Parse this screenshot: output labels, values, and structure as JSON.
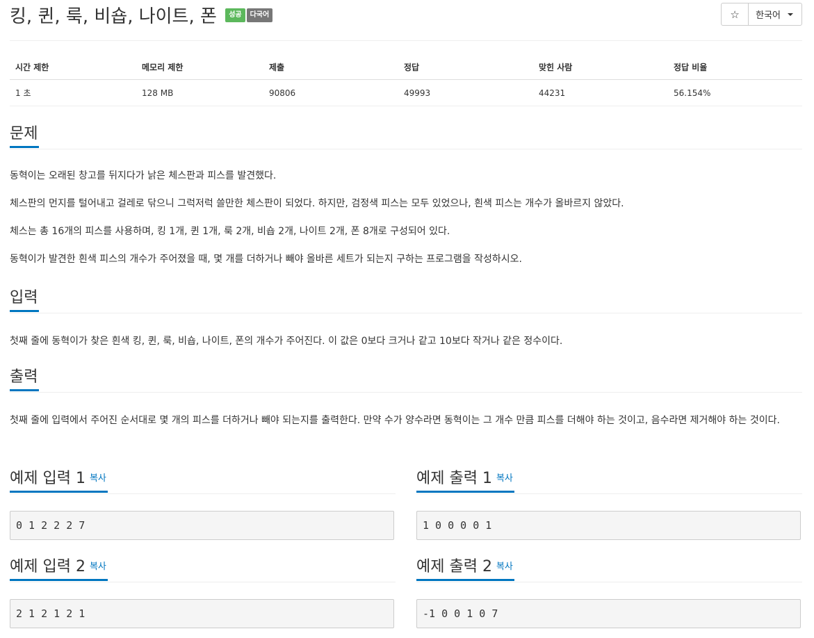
{
  "problem": {
    "title": "킹, 퀸, 룩, 비숍, 나이트, 폰",
    "badges": [
      "성공",
      "다국어"
    ],
    "star_icon": "☆",
    "language": "한국어",
    "colors": {
      "accent": "#0076c0",
      "success": "#5cb85c",
      "multilang": "#777777"
    }
  },
  "stats": {
    "headers": [
      "시간 제한",
      "메모리 제한",
      "제출",
      "정답",
      "맞힌 사람",
      "정답 비율"
    ],
    "values": [
      "1 초",
      "128 MB",
      "90806",
      "49993",
      "44231",
      "56.154%"
    ]
  },
  "description": {
    "title": "문제",
    "paragraphs": [
      "동혁이는 오래된 창고를 뒤지다가 낡은 체스판과 피스를 발견했다.",
      "체스판의 먼지를 털어내고 걸레로 닦으니 그럭저럭 쓸만한 체스판이 되었다. 하지만, 검정색 피스는 모두 있었으나, 흰색 피스는 개수가 올바르지 않았다.",
      "체스는 총 16개의 피스를 사용하며, 킹 1개, 퀸 1개, 룩 2개, 비숍 2개, 나이트 2개, 폰 8개로 구성되어 있다.",
      "동혁이가 발견한 흰색 피스의 개수가 주어졌을 때, 몇 개를 더하거나 빼야 올바른 세트가 되는지 구하는 프로그램을 작성하시오."
    ]
  },
  "input": {
    "title": "입력",
    "text": "첫째 줄에 동혁이가 찾은 흰색 킹, 퀸, 룩, 비숍, 나이트, 폰의 개수가 주어진다. 이 값은 0보다 크거나 같고 10보다 작거나 같은 정수이다."
  },
  "output": {
    "title": "출력",
    "text": "첫째 줄에 입력에서 주어진 순서대로 몇 개의 피스를 더하거나 빼야 되는지를 출력한다. 만약 수가 양수라면 동혁이는 그 개수 만큼 피스를 더해야 하는 것이고, 음수라면 제거해야 하는 것이다."
  },
  "samples": {
    "copy_label": "복사",
    "input1": {
      "title": "예제 입력 1",
      "value": "0 1 2 2 2 7"
    },
    "output1": {
      "title": "예제 출력 1",
      "value": "1 0 0 0 0 1"
    },
    "input2": {
      "title": "예제 입력 2",
      "value": "2 1 2 1 2 1"
    },
    "output2": {
      "title": "예제 출력 2",
      "value": "-1 0 0 1 0 7"
    }
  }
}
